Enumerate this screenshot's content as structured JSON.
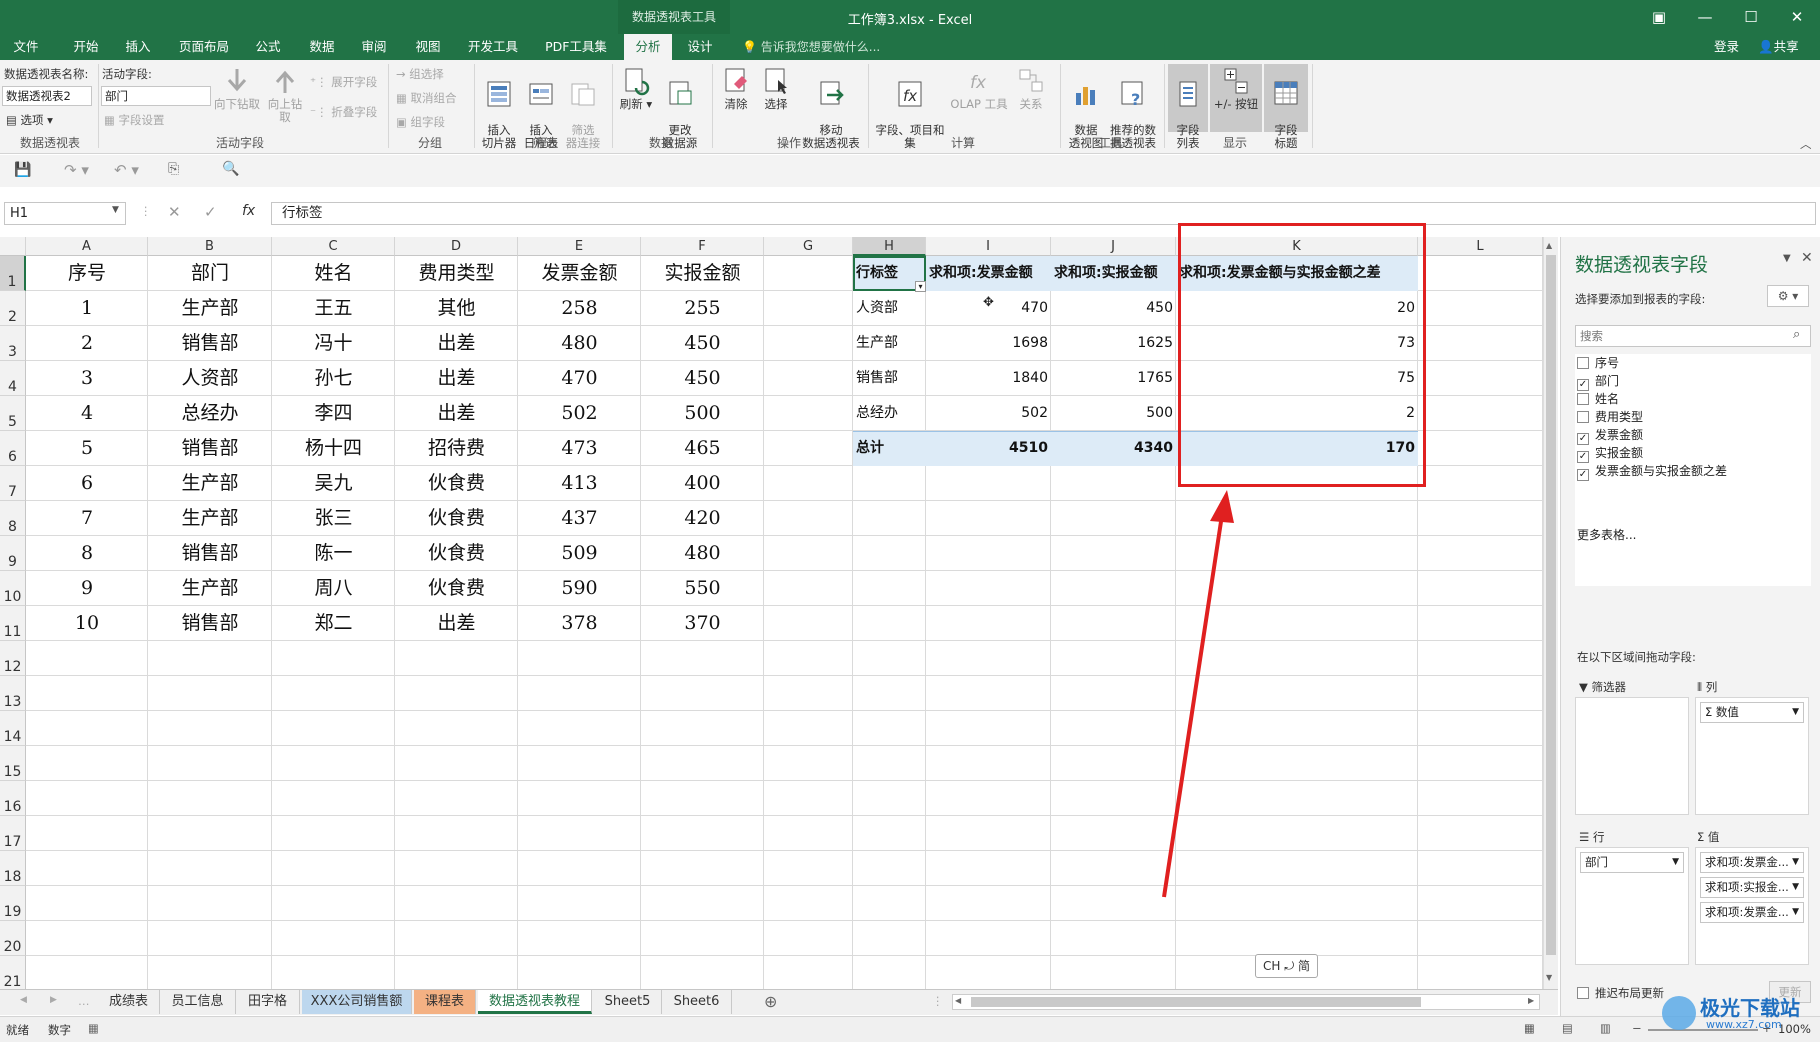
{
  "window": {
    "tool_context": "数据透视表工具",
    "title": "工作簿3.xlsx - Excel"
  },
  "tabs": [
    "文件",
    "开始",
    "插入",
    "页面布局",
    "公式",
    "数据",
    "审阅",
    "视图",
    "开发工具",
    "PDF工具集",
    "分析",
    "设计"
  ],
  "active_tab": "分析",
  "tell_me": "告诉我您想要做什么...",
  "login": "登录",
  "share": "共享",
  "ribbon": {
    "pt_name_label": "数据透视表名称:",
    "pt_name_value": "数据透视表2",
    "options": "选项",
    "grp_pt": "数据透视表",
    "active_field_label": "活动字段:",
    "active_field_value": "部门",
    "field_settings": "字段设置",
    "drill_down": "向下钻取",
    "drill_up": "向上钻取",
    "expand_field": "展开字段",
    "collapse_field": "折叠字段",
    "grp_active": "活动字段",
    "group_sel": "组选择",
    "ungroup": "取消组合",
    "group_field": "组字段",
    "grp_group": "分组",
    "insert_slicer": "插入\n切片器",
    "insert_timeline": "插入\n日程表",
    "filter_conn": "筛选\n器连接",
    "grp_filter": "筛选",
    "refresh": "刷新",
    "change_source": "更改\n数据源",
    "grp_data": "数据",
    "clear": "清除",
    "select": "选择",
    "move_pt": "移动\n数据透视表",
    "grp_actions": "操作",
    "fields_items": "字段、项目和\n集",
    "olap": "OLAP 工具",
    "relations": "关系",
    "grp_calc": "计算",
    "pivot_chart": "数据\n透视图",
    "recommended": "推荐的数\n据透视表",
    "grp_tools": "工具",
    "field_list": "字段\n列表",
    "plus_minus": "+/- 按钮",
    "field_headers": "字段\n标题",
    "grp_show": "显示"
  },
  "formula": {
    "namebox": "H1",
    "content": "行标签",
    "fx": "fx"
  },
  "columns": [
    "A",
    "B",
    "C",
    "D",
    "E",
    "F",
    "G",
    "H",
    "I",
    "J",
    "K",
    "L"
  ],
  "rows": [
    "1",
    "2",
    "3",
    "4",
    "5",
    "6",
    "7",
    "8",
    "9",
    "10",
    "11",
    "12",
    "13",
    "14",
    "15",
    "16",
    "17",
    "18",
    "19",
    "20",
    "21"
  ],
  "table": {
    "headers": [
      "序号",
      "部门",
      "姓名",
      "费用类型",
      "发票金额",
      "实报金额"
    ],
    "data": [
      [
        "1",
        "生产部",
        "王五",
        "其他",
        "258",
        "255"
      ],
      [
        "2",
        "销售部",
        "冯十",
        "出差",
        "480",
        "450"
      ],
      [
        "3",
        "人资部",
        "孙七",
        "出差",
        "470",
        "450"
      ],
      [
        "4",
        "总经办",
        "李四",
        "出差",
        "502",
        "500"
      ],
      [
        "5",
        "销售部",
        "杨十四",
        "招待费",
        "473",
        "465"
      ],
      [
        "6",
        "生产部",
        "吴九",
        "伙食费",
        "413",
        "400"
      ],
      [
        "7",
        "生产部",
        "张三",
        "伙食费",
        "437",
        "420"
      ],
      [
        "8",
        "销售部",
        "陈一",
        "伙食费",
        "509",
        "480"
      ],
      [
        "9",
        "生产部",
        "周八",
        "伙食费",
        "590",
        "550"
      ],
      [
        "10",
        "销售部",
        "郑二",
        "出差",
        "378",
        "370"
      ]
    ]
  },
  "pivot": {
    "headers": [
      "行标签",
      "求和项:发票金额",
      "求和项:实报金额",
      "求和项:发票金额与实报金额之差"
    ],
    "rows": [
      [
        "人资部",
        "470",
        "450",
        "20"
      ],
      [
        "生产部",
        "1698",
        "1625",
        "73"
      ],
      [
        "销售部",
        "1840",
        "1765",
        "75"
      ],
      [
        "总经办",
        "502",
        "500",
        "2"
      ]
    ],
    "total": [
      "总计",
      "4510",
      "4340",
      "170"
    ]
  },
  "sheets": [
    "成绩表",
    "员工信息",
    "田字格",
    "XXX公司销售额",
    "课程表",
    "数据透视表教程",
    "Sheet5",
    "Sheet6"
  ],
  "active_sheet": "数据透视表教程",
  "ime": "CH ⤾ 简",
  "pane": {
    "title": "数据透视表字段",
    "subtitle": "选择要添加到报表的字段:",
    "search_placeholder": "搜索",
    "fields": [
      {
        "name": "序号",
        "checked": false
      },
      {
        "name": "部门",
        "checked": true
      },
      {
        "name": "姓名",
        "checked": false
      },
      {
        "name": "费用类型",
        "checked": false
      },
      {
        "name": "发票金额",
        "checked": true
      },
      {
        "name": "实报金额",
        "checked": true
      },
      {
        "name": "发票金额与实报金额之差",
        "checked": true
      }
    ],
    "more_tables": "更多表格...",
    "areas_label": "在以下区域间拖动字段:",
    "filters": "筛选器",
    "columns": "列",
    "columns_item": "Σ 数值",
    "rows_label": "行",
    "rows_item": "部门",
    "values_label": "值",
    "values_items": [
      "求和项:发票金...",
      "求和项:实报金...",
      "求和项:发票金..."
    ],
    "defer": "推迟布局更新",
    "update": "更新"
  },
  "status": {
    "ready": "就绪",
    "mode": "数字",
    "zoom": "100%"
  },
  "watermark": "极光下载站",
  "watermark_url": "www.xz7.com",
  "accent": "#217346",
  "highlight": "#e02020"
}
